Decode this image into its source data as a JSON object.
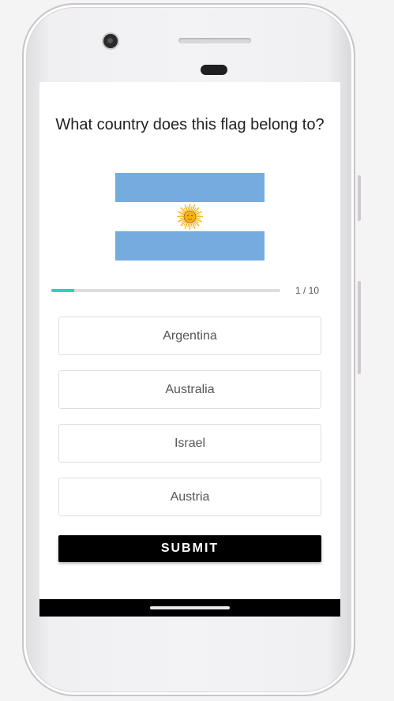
{
  "quiz": {
    "question": "What country does this flag belong to?",
    "flag_icon": "argentina-flag-icon",
    "progress": {
      "current": 1,
      "total": 10,
      "label": "1 / 10",
      "fraction": 0.1
    },
    "options": [
      {
        "label": "Argentina"
      },
      {
        "label": "Australia"
      },
      {
        "label": "Israel"
      },
      {
        "label": "Austria"
      }
    ],
    "submit_label": "SUBMIT"
  },
  "colors": {
    "accent": "#1fd6c1",
    "flag_blue": "#74acdf",
    "flag_sun": "#f6b40e",
    "button_bg": "#000000"
  }
}
